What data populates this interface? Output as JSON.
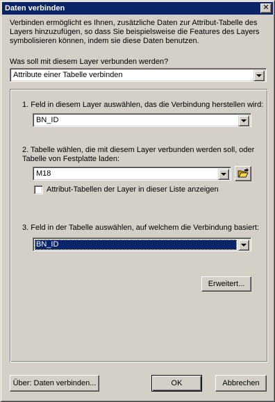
{
  "window": {
    "title": "Daten verbinden",
    "close_glyph": "✕"
  },
  "intro_text": "Verbinden ermöglicht es Ihnen, zusätzliche Daten zur Attribut-Tabelle des Layers hinzuzufügen, so dass Sie beispielsweise die Features des Layers symbolisieren können, indem sie diese Daten benutzen.",
  "join_type": {
    "question": "Was soll mit diesem Layer verbunden werden?",
    "selected": "Attribute einer Tabelle verbinden"
  },
  "step1": {
    "label": "1. Feld in diesem Layer auswählen, das die Verbindung herstellen wird:",
    "selected": "BN_ID"
  },
  "step2": {
    "label_line1": "2. Tabelle wählen, die mit diesem Layer verbunden werden soll, oder",
    "label_line2": "Tabelle von Festplatte laden:",
    "selected": "M18",
    "browse_icon": "open-folder-icon",
    "checkbox_label": "Attribut-Tabellen der Layer in dieser Liste anzeigen",
    "checkbox_checked": false
  },
  "step3": {
    "label": "3. Feld in der Tabelle auswählen, auf welchem die Verbindung basiert:",
    "selected": "BN_ID"
  },
  "buttons": {
    "advanced": "Erweitert...",
    "about": "Über: Daten verbinden...",
    "ok": "OK",
    "cancel": "Abbrechen"
  },
  "colors": {
    "face": "#d4d0c8",
    "titlebar": "#0a246a",
    "selection": "#0a246a"
  }
}
